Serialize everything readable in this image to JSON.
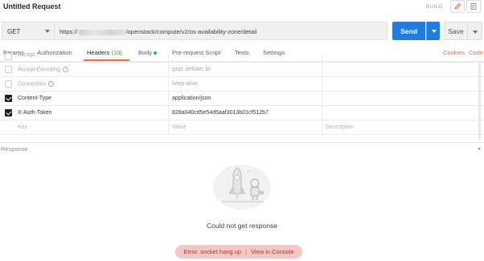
{
  "titlebar": {
    "title": "Untitled Request",
    "build_label": "BUILD",
    "edit_icon": "pencil-icon",
    "doc_icon": "document-icon"
  },
  "request": {
    "method": "GET",
    "url_prefix": "https://",
    "url_path": "/openstack/compute/v2/os-availability-zone/detail",
    "send_label": "Send",
    "save_label": "Save"
  },
  "tabs": {
    "params": "Params",
    "authorization": "Authorization",
    "headers": "Headers",
    "headers_count": "(10)",
    "body": "Body",
    "prerequest": "Pre-request Script",
    "tests": "Tests",
    "settings": "Settings",
    "cookies": "Cookies",
    "code": "Code"
  },
  "headers_table": {
    "rows": [
      {
        "key": "Accept",
        "value": "",
        "checked": false,
        "dim": true
      },
      {
        "key": "Accept-Encoding",
        "value": "gzip, deflate, br",
        "checked": false,
        "dim": true
      },
      {
        "key": "Connection",
        "value": "keep-alive",
        "checked": false,
        "dim": true
      },
      {
        "key": "Content-Type",
        "value": "application/json",
        "checked": true,
        "dim": false
      },
      {
        "key": "X-Auth-Token",
        "value": "828a040cd5e54d5aaf3013b01cf512b7",
        "checked": true,
        "dim": false
      }
    ],
    "placeholder_key": "Key",
    "placeholder_value": "Value",
    "placeholder_desc": "Description"
  },
  "response": {
    "label": "Response",
    "message": "Could not get response",
    "error_text": "Error: socket hang up",
    "view_console": "View in Console",
    "illustration": "astronaut-rocket-illustration"
  },
  "colors": {
    "accent_orange": "#f26b3a",
    "send_blue": "#1f7de2",
    "error_bg": "#f4c6c4",
    "count_green": "#2e9b3a"
  }
}
